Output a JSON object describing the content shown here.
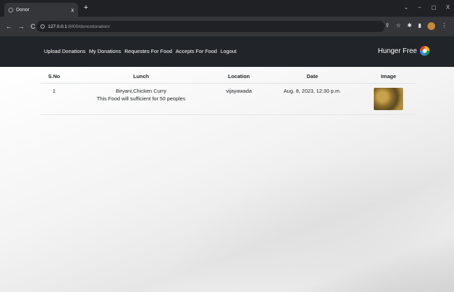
{
  "browser": {
    "tab_title": "Donor",
    "tab_close": "x",
    "new_tab": "+",
    "url_host": "127.0.0.1",
    "url_path": ":8000/donordonation/",
    "controls": [
      "⌄",
      "–",
      "▢",
      "X"
    ]
  },
  "nav": {
    "items": [
      "Upload Donations",
      "My Donations",
      "Requestes For Food",
      "Accepts For Food",
      "Logout"
    ],
    "brand": "Hunger Free"
  },
  "table": {
    "headers": [
      "S.No",
      "Lunch",
      "Location",
      "Date",
      "Image"
    ],
    "rows": [
      {
        "sno": "1",
        "lunch_title": "Biryani,Chicken Curry",
        "lunch_desc": "This Food will sufficient for 50 peoples",
        "location": "vijayawada",
        "date": "Aug. 8, 2023, 12:30 p.m."
      }
    ]
  }
}
